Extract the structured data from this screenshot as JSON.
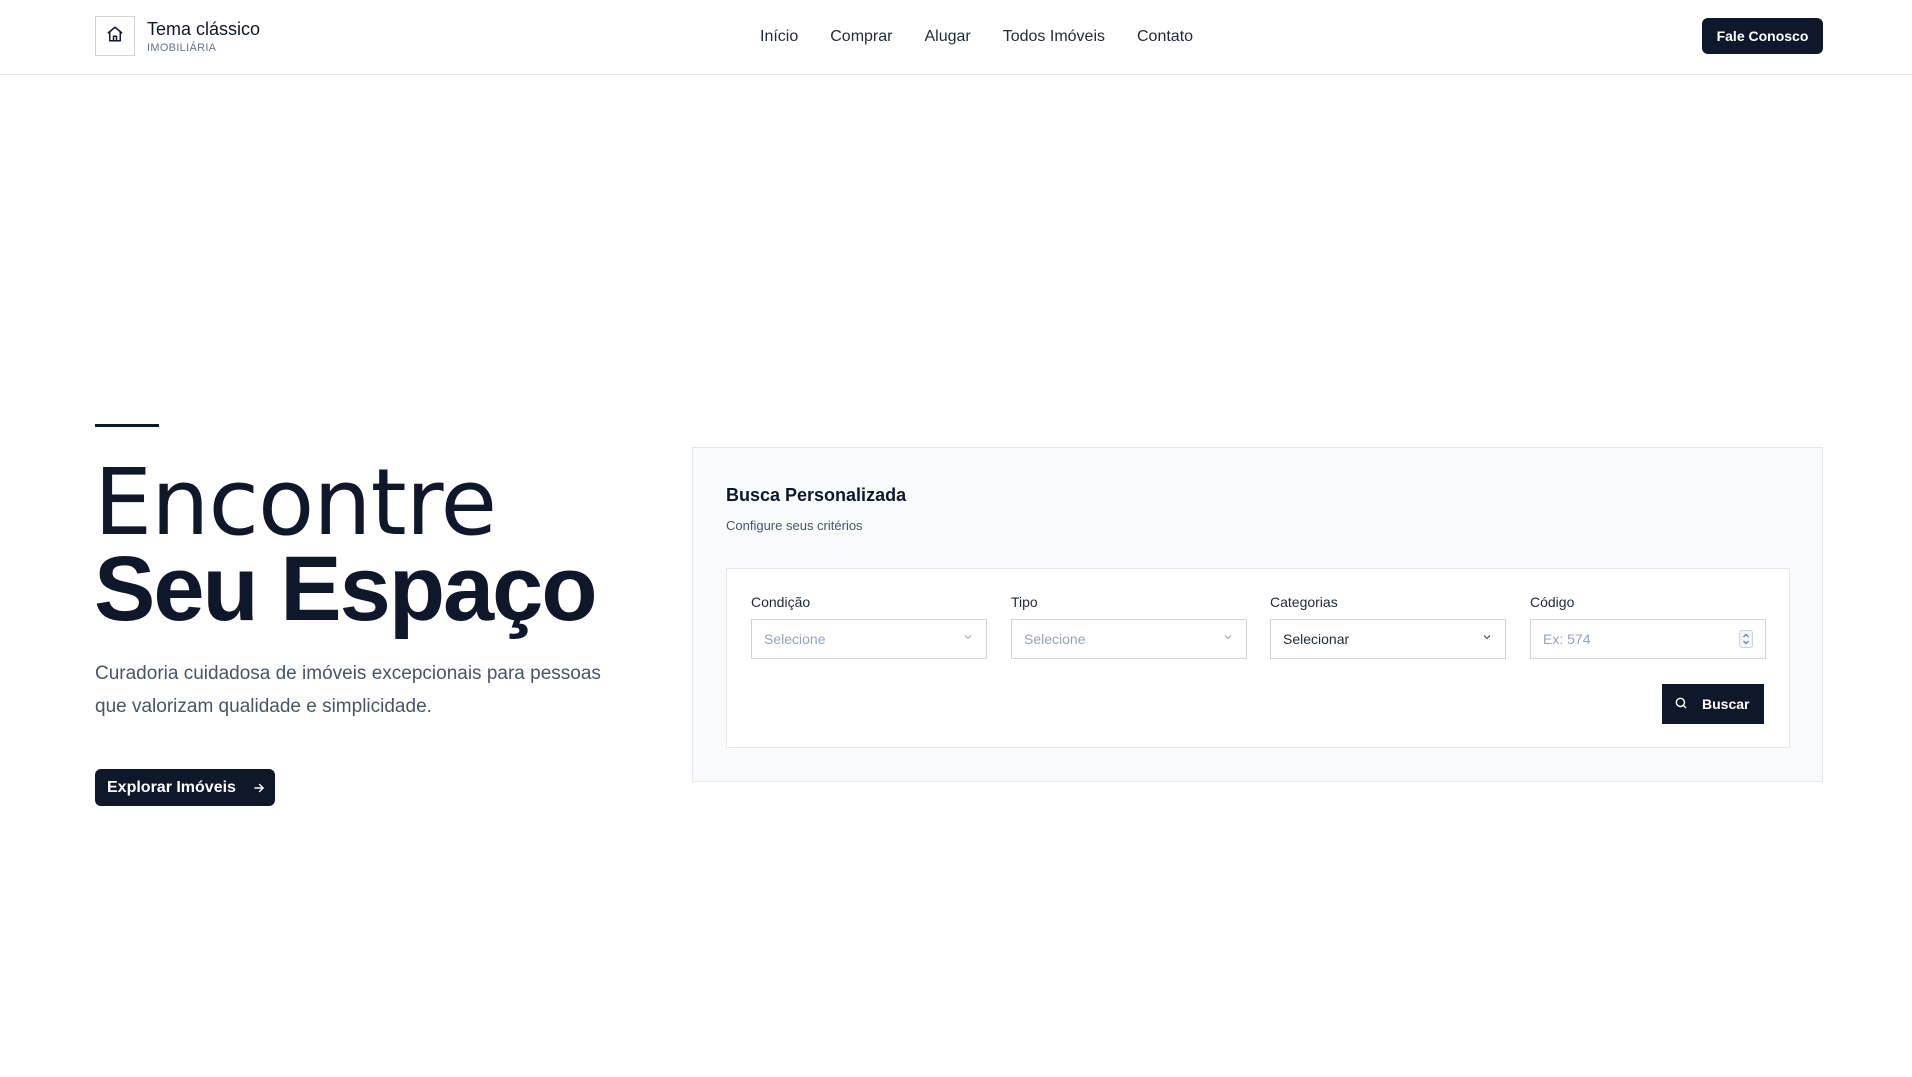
{
  "header": {
    "brand_name": "Tema clássico",
    "brand_sub": "IMOBILIÁRIA",
    "brand_icon": "home-icon",
    "nav": [
      "Início",
      "Comprar",
      "Alugar",
      "Todos Imóveis",
      "Contato"
    ],
    "cta_label": "Fale Conosco"
  },
  "hero": {
    "title_line1": "Encontre",
    "title_line2": "Seu Espaço",
    "description": "Curadoria cuidadosa de imóveis excepcionais para pessoas que valorizam qualidade e simplicidade.",
    "button_label": "Explorar Imóveis",
    "button_icon": "arrow-right-icon"
  },
  "search": {
    "title": "Busca Personalizada",
    "subtitle": "Configure seus critérios",
    "fields": {
      "condicao": {
        "label": "Condição",
        "value": "Selecione"
      },
      "tipo": {
        "label": "Tipo",
        "value": "Selecione"
      },
      "categorias": {
        "label": "Categorias",
        "value": "Selecionar"
      },
      "codigo": {
        "label": "Código",
        "placeholder": "Ex: 574"
      }
    },
    "button_label": "Buscar",
    "button_icon": "search-icon"
  },
  "colors": {
    "primary": "#0f172a",
    "muted_text": "#475569",
    "panel_bg": "#f8fafc",
    "border": "#e5e7eb"
  }
}
